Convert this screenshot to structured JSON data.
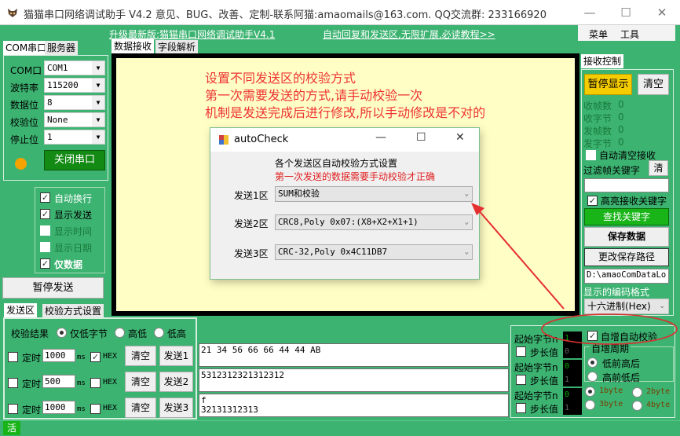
{
  "window": {
    "title": "猫猫串口网络调试助手 V4.2 意见、BUG、改善、定制-联系阿猫:amaomails@163.com. QQ交流群: 233166920",
    "minimize_glyph": "—",
    "maximize_glyph": "☐",
    "close_glyph": "✕"
  },
  "links": {
    "upgrade": "升级最新版:猫猫串口网络调试助手V4.1",
    "tutorial": "自动回复和发送区,无限扩展,必读教程>>"
  },
  "menu": {
    "menu": "菜单",
    "tools": "工具"
  },
  "left_tabs": {
    "com": "COM串口",
    "server": "服务器"
  },
  "center_tabs": {
    "recv": "数据接收",
    "parse": "字段解析"
  },
  "serial": {
    "fields": [
      {
        "label": "COM口",
        "value": "COM1"
      },
      {
        "label": "波特率",
        "value": "115200"
      },
      {
        "label": "数据位",
        "value": "8"
      },
      {
        "label": "校验位",
        "value": "None"
      },
      {
        "label": "停止位",
        "value": "1"
      }
    ],
    "close_port": "关闭串口",
    "status_color": "#f5a300"
  },
  "display_options": [
    {
      "label": "自动换行",
      "checked": true
    },
    {
      "label": "显示发送",
      "checked": true
    },
    {
      "label": "显示时间",
      "checked": false
    },
    {
      "label": "显示日期",
      "checked": false
    },
    {
      "label": "仅数据",
      "checked": true
    }
  ],
  "pause_send": "暂停发送",
  "send_tabs": {
    "send_area": "发送区",
    "check_settings": "校验方式设置"
  },
  "check_result": {
    "label": "校验结果",
    "options": [
      {
        "label": "仅低字节",
        "selected": true
      },
      {
        "label": "高低",
        "selected": false
      },
      {
        "label": "低高",
        "selected": false
      }
    ]
  },
  "send_rows": [
    {
      "timer_label": "定时",
      "timer_checked": false,
      "interval": "1000",
      "unit": "ms",
      "hex_label": "HEX",
      "hex_checked": true,
      "clear": "清空",
      "send": "发送1",
      "content": "21 34 56 66 66 44 44 AB",
      "start_byte_label": "起始字节n",
      "start_byte": "1",
      "step_label": "步长值",
      "step_checked": false,
      "step": "0"
    },
    {
      "timer_label": "定时",
      "timer_checked": false,
      "interval": "500",
      "unit": "ms",
      "hex_label": "HEX",
      "hex_checked": false,
      "clear": "清空",
      "send": "发送2",
      "content": "5312312321312312",
      "start_byte_label": "起始字节n",
      "start_byte": "0",
      "step_label": "步长值",
      "step_checked": false,
      "step": "1"
    },
    {
      "timer_label": "定时",
      "timer_checked": false,
      "interval": "1000",
      "unit": "ms",
      "hex_label": "HEX",
      "hex_checked": false,
      "clear": "清空",
      "send": "发送3",
      "content": "f\n32131312313",
      "start_byte_label": "起始字节n",
      "start_byte": "0",
      "step_label": "步长值",
      "step_checked": false,
      "step": "1"
    }
  ],
  "auto_inc": {
    "label": "自增自动校验",
    "checked": true,
    "period_label": "自增周期",
    "order_options": [
      {
        "label": "低前高后",
        "selected": true
      },
      {
        "label": "高前低后",
        "selected": false
      }
    ],
    "size_options": [
      {
        "label": "1byte",
        "selected": true
      },
      {
        "label": "2byte",
        "selected": false
      },
      {
        "label": "3byte",
        "selected": false
      },
      {
        "label": "4byte",
        "selected": false
      }
    ]
  },
  "recv_control": {
    "tab": "接收控制",
    "pause_display": "暂停显示",
    "clear": "清空",
    "stats": [
      {
        "label": "收帧数",
        "value": "0"
      },
      {
        "label": "收字节",
        "value": "0"
      },
      {
        "label": "发帧数",
        "value": "0"
      },
      {
        "label": "发字节",
        "value": "0"
      }
    ],
    "auto_clear": "自动清空接收",
    "auto_clear_checked": false,
    "filter_label": "过滤帧关键字",
    "filter_clear": "清",
    "filter_value": "",
    "highlight": "高亮接收关键字",
    "highlight_checked": true,
    "find_keyword": "查找关键字",
    "save_data": "保存数据",
    "change_path": "更改保存路径",
    "path": "D:\\amaoComDataLo",
    "encoding_label": "显示的编码格式",
    "encoding_value": "十六进制(Hex)"
  },
  "annotation": {
    "lines": [
      "设置不同发送区的校验方式",
      "第一次需要发送的方式,请手动校验一次",
      "机制是发送完成后进行修改,所以手动修改是不对的"
    ],
    "color": "#e53333"
  },
  "dialog": {
    "title": "autoCheck",
    "heading": "各个发送区自动校验方式设置",
    "warning": "第一次发送的数据需要手动校验才正确",
    "rows": [
      {
        "label": "发送1区",
        "value": "SUM和校验"
      },
      {
        "label": "发送2区",
        "value": "CRC8,Poly 0x07:(X8+X2+X1+1)"
      },
      {
        "label": "发送3区",
        "value": "CRC-32,Poly 0x4C11DB7"
      }
    ]
  },
  "status_bar": {
    "active": "活"
  },
  "colors": {
    "app_green": "#3cb371",
    "recv_bg": "#ffffc5",
    "find_green": "#18b418",
    "close_port_green": "#138a13",
    "pause_yellow": "#f5cc00"
  }
}
